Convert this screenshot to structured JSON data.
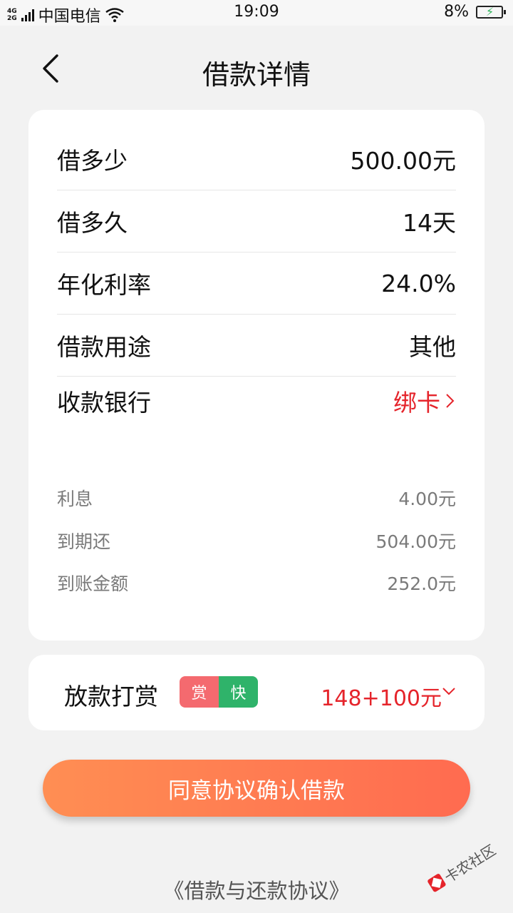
{
  "status_bar": {
    "net_top": "4G",
    "net_bottom": "2G",
    "carrier": "中国电信",
    "time": "19:09",
    "battery": "8%"
  },
  "header": {
    "title": "借款详情"
  },
  "details": {
    "rows": [
      {
        "label": "借多少",
        "value": "500.00元"
      },
      {
        "label": "借多久",
        "value": "14天"
      },
      {
        "label": "年化利率",
        "value": "24.0%"
      },
      {
        "label": "借款用途",
        "value": "其他"
      },
      {
        "label": "收款银行",
        "value": "绑卡"
      }
    ],
    "minor": [
      {
        "label": "利息",
        "value": "4.00元"
      },
      {
        "label": "到期还",
        "value": "504.00元"
      },
      {
        "label": "到账金额",
        "value": "252.0元"
      }
    ]
  },
  "reward": {
    "label": "放款打赏",
    "badge_1": "赏",
    "badge_2": "快",
    "amount": "148+100元"
  },
  "confirm_button": {
    "label": "同意协议确认借款"
  },
  "agreement_link": {
    "label": "《借款与还款协议》"
  },
  "watermark": {
    "text": "卡农社区"
  },
  "colors": {
    "accent_red": "#e5242b",
    "button_gradient_start": "#ff8e53",
    "button_gradient_end": "#ff6b50",
    "badge_red": "#f46a6f",
    "badge_green": "#2fb36a"
  }
}
